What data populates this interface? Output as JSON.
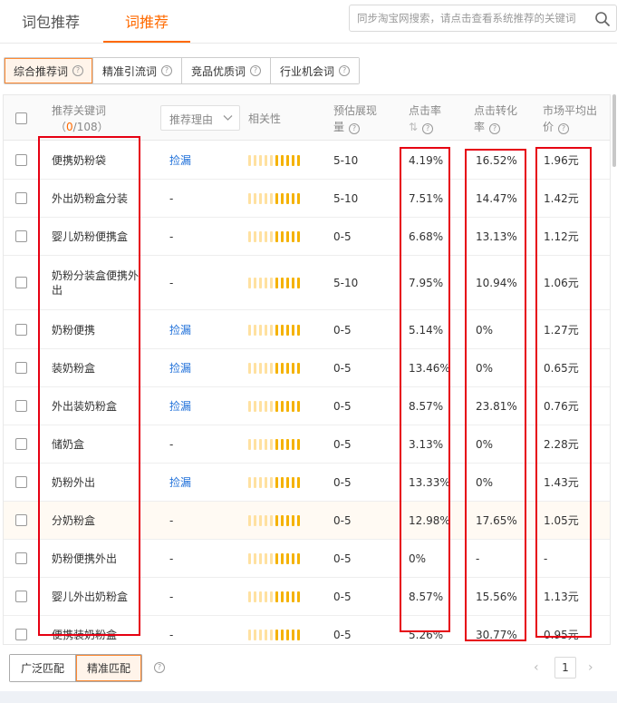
{
  "tabs": [
    {
      "label": "词包推荐",
      "active": false
    },
    {
      "label": "词推荐",
      "active": true
    }
  ],
  "search": {
    "placeholder": "同步淘宝网搜索，请点击查看系统推荐的关键词"
  },
  "filters": [
    {
      "label": "综合推荐词",
      "active": true
    },
    {
      "label": "精准引流词",
      "active": false
    },
    {
      "label": "竞品优质词",
      "active": false
    },
    {
      "label": "行业机会词",
      "active": false
    }
  ],
  "table": {
    "headers": {
      "keyword": "推荐关键词",
      "count_open": "（",
      "count_selected": "0",
      "count_total": "/108）",
      "reason": "推荐理由",
      "relevance": "相关性",
      "impressions_line1": "预估展现",
      "impressions_line2": "量",
      "ctr": "点击率",
      "cvr_line1": "点击转化",
      "cvr_line2": "率",
      "price_line1": "市场平均出",
      "price_line2": "价"
    },
    "rows": [
      {
        "keyword": "便携奶粉袋",
        "reason": "捡漏",
        "impressions": "5-10",
        "ctr": "4.19%",
        "cvr": "16.52%",
        "price": "1.96元"
      },
      {
        "keyword": "外出奶粉盒分装",
        "reason": "-",
        "impressions": "5-10",
        "ctr": "7.51%",
        "cvr": "14.47%",
        "price": "1.42元"
      },
      {
        "keyword": "婴儿奶粉便携盒",
        "reason": "-",
        "impressions": "0-5",
        "ctr": "6.68%",
        "cvr": "13.13%",
        "price": "1.12元"
      },
      {
        "keyword": "奶粉分装盒便携外",
        "keyword2": "出",
        "reason": "-",
        "impressions": "5-10",
        "ctr": "7.95%",
        "cvr": "10.94%",
        "price": "1.06元"
      },
      {
        "keyword": "奶粉便携",
        "reason": "捡漏",
        "impressions": "0-5",
        "ctr": "5.14%",
        "cvr": "0%",
        "price": "1.27元"
      },
      {
        "keyword": "装奶粉盒",
        "reason": "捡漏",
        "impressions": "0-5",
        "ctr": "13.46%",
        "cvr": "0%",
        "price": "0.65元"
      },
      {
        "keyword": "外出装奶粉盒",
        "reason": "捡漏",
        "impressions": "0-5",
        "ctr": "8.57%",
        "cvr": "23.81%",
        "price": "0.76元"
      },
      {
        "keyword": "储奶盒",
        "reason": "-",
        "impressions": "0-5",
        "ctr": "3.13%",
        "cvr": "0%",
        "price": "2.28元"
      },
      {
        "keyword": "奶粉外出",
        "reason": "捡漏",
        "impressions": "0-5",
        "ctr": "13.33%",
        "cvr": "0%",
        "price": "1.43元"
      },
      {
        "keyword": "分奶粉盒",
        "reason": "-",
        "impressions": "0-5",
        "ctr": "12.98%",
        "cvr": "17.65%",
        "price": "1.05元"
      },
      {
        "keyword": "奶粉便携外出",
        "reason": "-",
        "impressions": "0-5",
        "ctr": "0%",
        "cvr": "-",
        "price": "-"
      },
      {
        "keyword": "婴儿外出奶粉盒",
        "reason": "-",
        "impressions": "0-5",
        "ctr": "8.57%",
        "cvr": "15.56%",
        "price": "1.13元"
      },
      {
        "keyword": "便携装奶粉盒",
        "reason": "-",
        "impressions": "0-5",
        "ctr": "5.26%",
        "cvr": "30.77%",
        "price": "0.95元"
      }
    ]
  },
  "footer": {
    "match_options": [
      {
        "label": "广泛匹配",
        "active": false
      },
      {
        "label": "精准匹配",
        "active": true
      }
    ],
    "page": "1"
  },
  "colors": {
    "accent": "#ff6a00",
    "link": "#1e6fd9",
    "annotation": "#e60012",
    "bar_light": "#ffe1a0",
    "bar_dark": "#f5b200"
  },
  "icons": [
    "search-icon",
    "help-icon",
    "chevron-down-icon",
    "sort-icon",
    "checkbox-icon",
    "chevron-left-icon",
    "chevron-right-icon"
  ]
}
